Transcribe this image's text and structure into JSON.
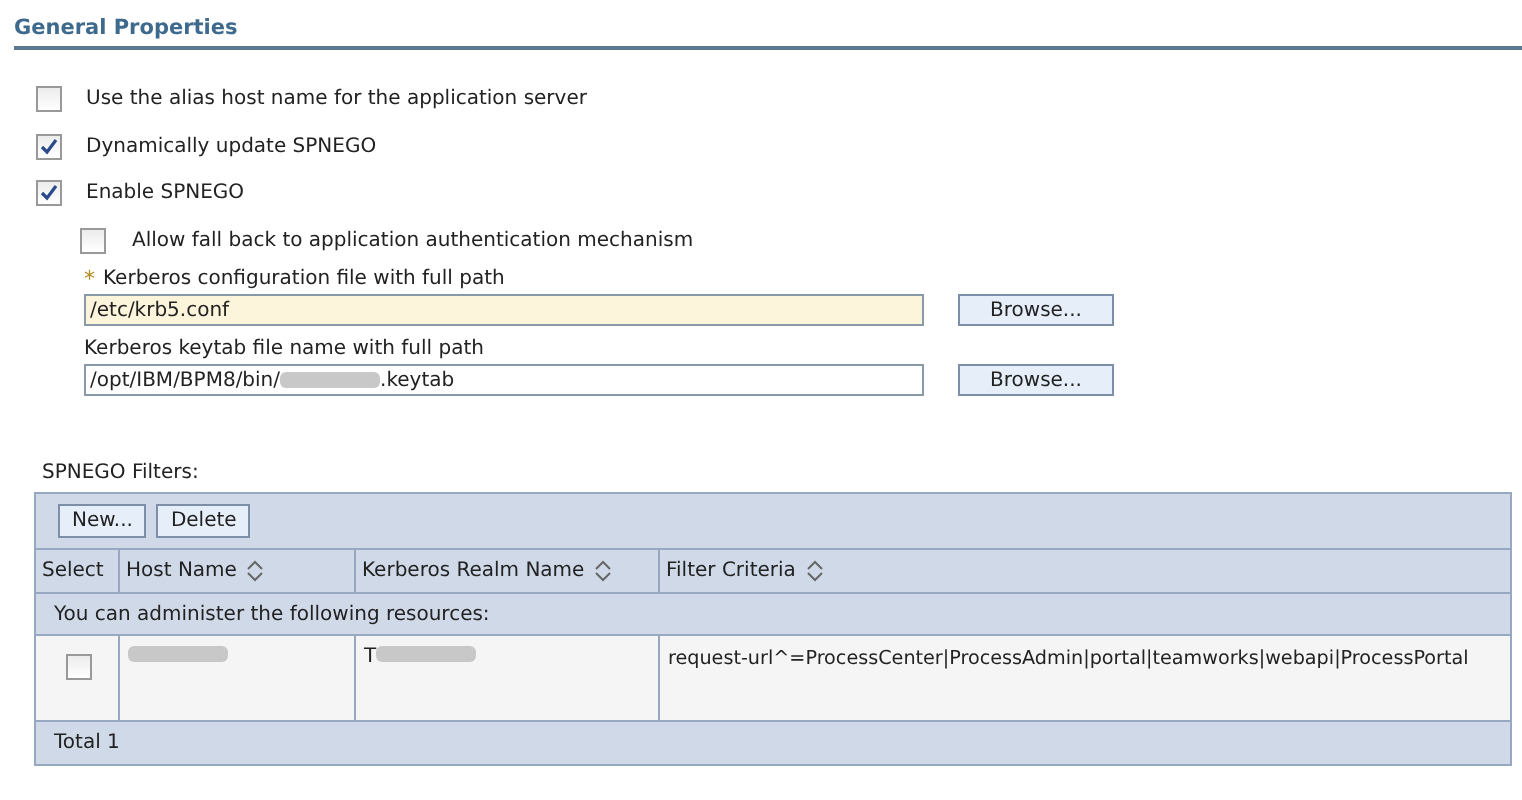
{
  "section_title": "General Properties",
  "options": [
    {
      "label": "Use the alias host name for the application server",
      "checked": false
    },
    {
      "label": "Dynamically update SPNEGO",
      "checked": true
    },
    {
      "label": "Enable SPNEGO",
      "checked": true,
      "children": [
        {
          "label": "Allow fall back to application authentication mechanism",
          "checked": false
        }
      ]
    }
  ],
  "fields": [
    {
      "label": "Kerberos configuration file with full path",
      "required": true,
      "required_mark": "*",
      "value_parts": [
        {
          "kind": "text",
          "text": "/etc/krb5.conf"
        }
      ],
      "button": "Browse..."
    },
    {
      "label": "Kerberos keytab file name with full path",
      "required": false,
      "value_parts": [
        {
          "kind": "text",
          "text": "/opt/IBM/BPM8/bin/"
        },
        {
          "kind": "redacted"
        },
        {
          "kind": "text",
          "text": ".keytab"
        }
      ],
      "button": "Browse..."
    }
  ],
  "filters": {
    "title": "SPNEGO Filters:",
    "buttons": [
      "New...",
      "Delete"
    ],
    "columns": [
      {
        "label": "Select",
        "sortable": false
      },
      {
        "label": "Host Name",
        "sortable": true
      },
      {
        "label": "Kerberos Realm Name",
        "sortable": true
      },
      {
        "label": "Filter Criteria",
        "sortable": true
      }
    ],
    "info": "You can administer the following resources:",
    "rows": [
      {
        "selected": false,
        "host_name": [
          {
            "kind": "redacted"
          }
        ],
        "realm": [
          {
            "kind": "text",
            "text": "T"
          },
          {
            "kind": "redacted"
          }
        ],
        "filter_criteria": "request-url^=ProcessCenter|ProcessAdmin|portal|teamworks|webapi|ProcessPortal"
      }
    ],
    "total": "Total 1"
  }
}
